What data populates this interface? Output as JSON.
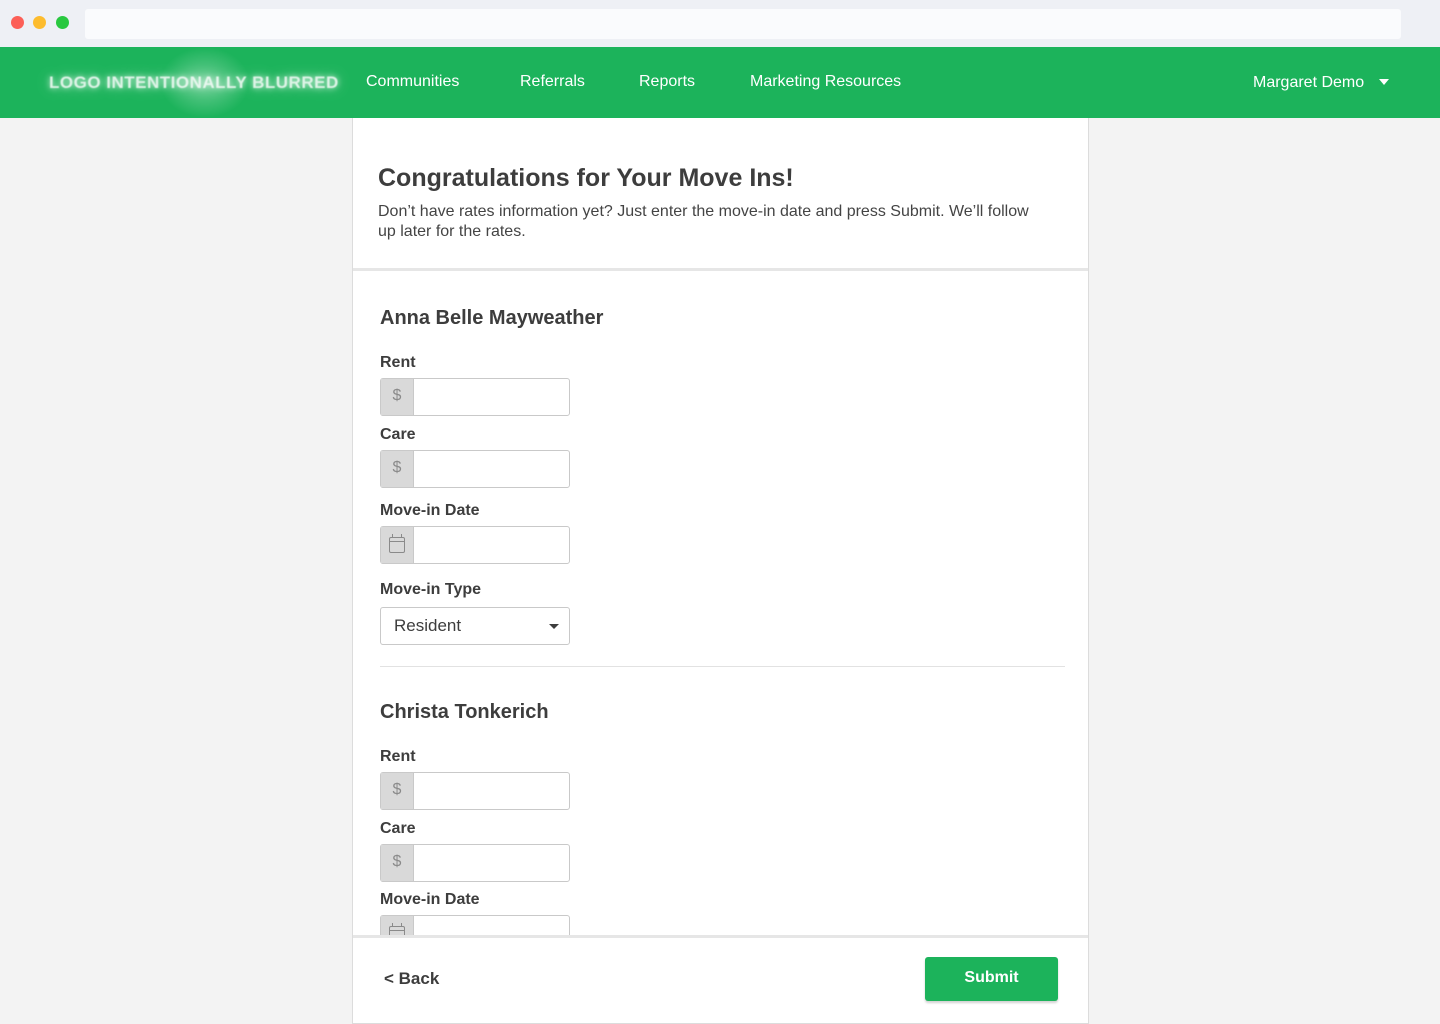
{
  "nav": {
    "logo_text": "LOGO INTENTIONALLY BLURRED",
    "links": [
      "Communities",
      "Referrals",
      "Reports",
      "Marketing Resources"
    ],
    "user_name": "Margaret Demo"
  },
  "page": {
    "title": "Congratulations for Your Move Ins!",
    "subtitle": "Don’t have rates information yet? Just enter the move-in date and press Submit. We’ll follow up later for the rates."
  },
  "residents": [
    {
      "name": "Anna Belle Mayweather",
      "rent_label": "Rent",
      "rent_value": "",
      "care_label": "Care",
      "care_value": "",
      "date_label": "Move-in Date",
      "date_value": "",
      "type_label": "Move-in Type",
      "type_value": "Resident"
    },
    {
      "name": "Christa Tonkerich",
      "rent_label": "Rent",
      "rent_value": "",
      "care_label": "Care",
      "care_value": "",
      "date_label": "Move-in Date",
      "date_value": ""
    }
  ],
  "currency_symbol": "$",
  "icons": {
    "date": "calendar-icon",
    "dropdown": "chevron-down-icon"
  },
  "footer": {
    "back_label": "< Back",
    "submit_label": "Submit"
  },
  "colors": {
    "brand": "#1cb35b"
  }
}
